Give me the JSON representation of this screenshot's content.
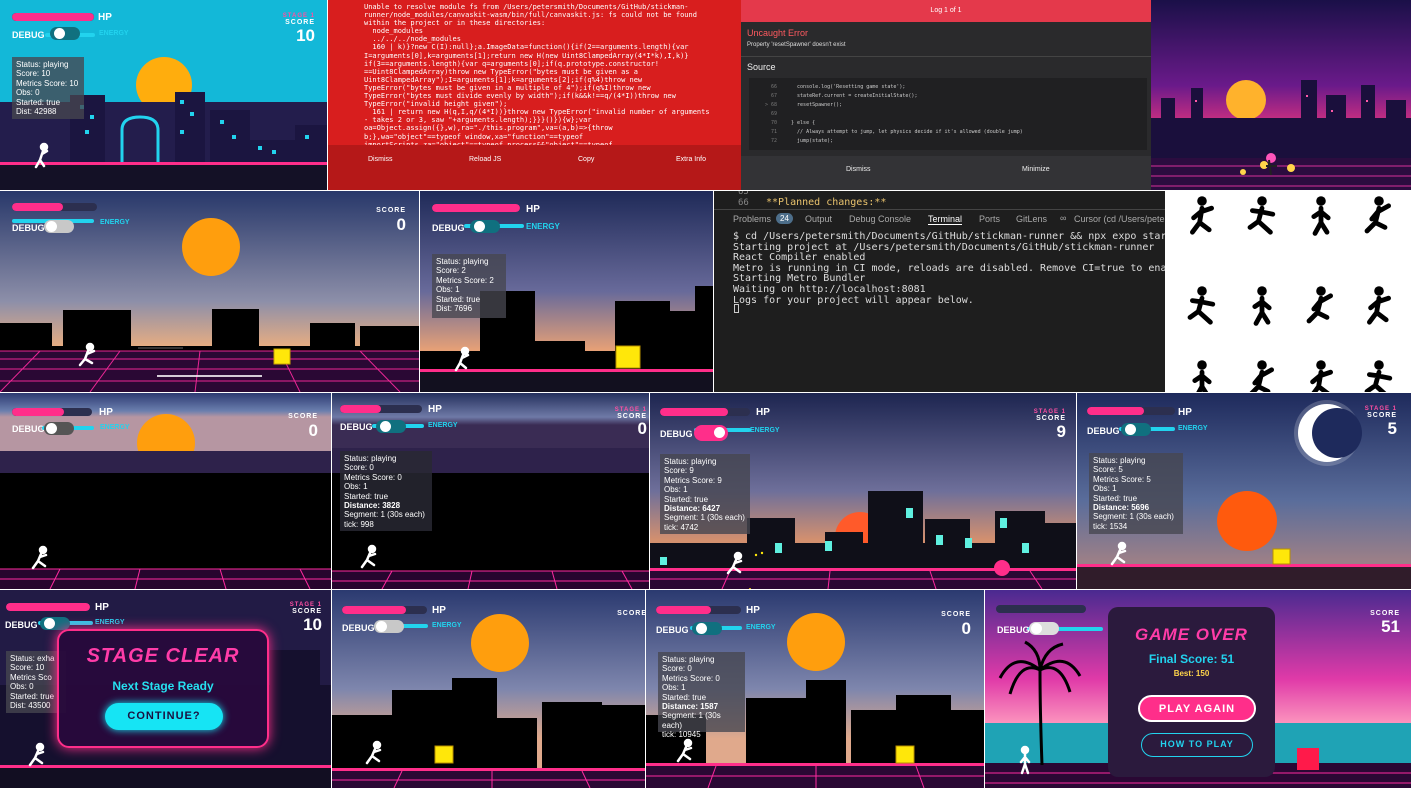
{
  "hud": {
    "hp": "HP",
    "debug": "DEBUG",
    "energy": "ENERGY",
    "score": "SCORE",
    "stage": "STAGE 1"
  },
  "tiles": {
    "t1": {
      "score": "10",
      "status": "Status: playing",
      "score_line": "Score: 10",
      "metrics": "Metrics Score: 10",
      "obs": "Obs: 0",
      "started": "Started: true",
      "dist": "Dist: 42988"
    },
    "t2": {
      "lines": [
        "Unable to resolve module fs from /Users/petersmith/Documents/GitHub/stickman-",
        "runner/node_modules/canvaskit-wasm/bin/full/canvaskit.js: fs could not be found",
        "within the project or in these directories:",
        "  node_modules",
        "  ../../../node_modules",
        "  160 | k)}?new C(I):null};a.ImageData=function(){if(2==arguments.length){var",
        "I=arguments[0],k=arguments[1];return new H(new Uint8ClampedArray(4*I*k),I,k)}",
        "if(3==arguments.length){var q=arguments[0];if(q.prototype.constructor!",
        "==Uint8ClampedArray)throw new TypeError(\"bytes must be given as a",
        "Uint8ClampedArray\");I=arguments[1];k=arguments[2];if(q%4)throw new",
        "TypeError(\"bytes must be given in a multiple of 4\");if(q%I)throw new",
        "TypeError(\"bytes must divide evenly by width\");if(k&&k!==q/(4*I))throw new",
        "TypeError(\"invalid height given\");",
        "  161 | return new H(q,I,q/(4*I))}throw new TypeError(\"invalid number of arguments",
        "- takes 2 or 3, saw \"+arguments.length);}}}()}){w};var",
        "oa=Object.assign({},w),ra=\"./this.program\",va=(a,b)=>{throw",
        "b;},wa=\"object\"==typeof window,xa=\"function\"==typeof",
        "importScripts,za=\"object\"==typeof process&&\"object\"==typeof"
      ],
      "buttons": [
        "Dismiss",
        "Reload JS",
        "Copy",
        "Extra Info"
      ]
    },
    "t3": {
      "title": "Log 1 of 1",
      "error_title": "Uncaught Error",
      "error_msg": "Property 'resetSpawner' doesn't exist",
      "source_label": "Source",
      "code": [
        {
          "n": "66",
          "t": "    console.log('Resetting game state');"
        },
        {
          "n": "67",
          "t": "    stateRef.current = createInitialState();"
        },
        {
          "n": "> 68",
          "t": "    resetSpawner();"
        },
        {
          "n": "69",
          "t": ""
        },
        {
          "n": "70",
          "t": "  } else {"
        },
        {
          "n": "71",
          "t": "    // Always attempt to jump, let physics decide if it's allowed (double jump)"
        },
        {
          "n": "72",
          "t": "    jump(state);"
        }
      ],
      "buttons": [
        "Dismiss",
        "Minimize"
      ]
    },
    "t5": {
      "score": "0"
    },
    "t6": {
      "score": "",
      "status": "Status: playing",
      "score_line": "Score: 2",
      "metrics": "Metrics Score: 2",
      "obs": "Obs: 1",
      "started": "Started: true",
      "dist": "Dist: 7696"
    },
    "t7": {
      "line_no": "65",
      "line_no2": "66",
      "planned": "**Planned changes:**",
      "tabs": [
        "Problems",
        "Output",
        "Debug Console",
        "Terminal",
        "Ports",
        "GitLens",
        "Cursor (cd /Users/peter"
      ],
      "problems_count": "24",
      "lines": [
        "$ cd /Users/petersmith/Documents/GitHub/stickman-runner && npx expo start",
        "Starting project at /Users/petersmith/Documents/GitHub/stickman-runner",
        "React Compiler enabled",
        "Metro is running in CI mode, reloads are disabled. Remove CI=true to enable watch mode.",
        "Starting Metro Bundler",
        "Waiting on http://localhost:8081",
        "Logs for your project will appear below."
      ]
    },
    "t9": {
      "score": "0"
    },
    "t10": {
      "score": "0",
      "status": "Status: playing",
      "score_line": "Score: 0",
      "metrics": "Metrics Score: 0",
      "obs": "Obs: 1",
      "started": "Started: true",
      "distance": "Distance: 3828",
      "segment": "Segment: 1 (30s each)",
      "tick": "tick: 998"
    },
    "t11": {
      "score": "9",
      "status": "Status: playing",
      "score_line": "Score: 9",
      "metrics": "Metrics Score: 9",
      "obs": "Obs: 1",
      "started": "Started: true",
      "distance": "Distance: 6427",
      "segment": "Segment: 1 (30s each)",
      "tick": "tick: 4742"
    },
    "t12": {
      "score": "5",
      "status": "Status: playing",
      "score_line": "Score: 5",
      "metrics": "Metrics Score: 5",
      "obs": "Obs: 1",
      "started": "Started: true",
      "distance": "Distance: 5696",
      "segment": "Segment: 1 (30s each)",
      "tick": "tick: 1534"
    },
    "t13": {
      "score": "10",
      "status": "Status: exha",
      "score_line": "Score: 10",
      "metrics": "Metrics Sco",
      "obs": "Obs: 0",
      "started": "Started: true",
      "dist": "Dist: 43500",
      "title": "STAGE CLEAR",
      "subtitle": "Next Stage Ready",
      "button": "CONTINUE?"
    },
    "t14": {
      "score": ""
    },
    "t15": {
      "score": "0",
      "status": "Status: playing",
      "score_line": "Score: 0",
      "metrics": "Metrics Score: 0",
      "obs": "Obs: 1",
      "started": "Started: true",
      "distance": "Distance: 1587",
      "segment": "Segment: 1 (30s each)",
      "tick": "tick: 10945"
    },
    "t16": {
      "score": "51",
      "title": "GAME OVER",
      "final": "Final Score: 51",
      "best": "Best: 150",
      "play": "PLAY AGAIN",
      "how": "HOW TO PLAY"
    }
  },
  "colors": {
    "accent_pink": "#ff2e8a",
    "accent_cyan": "#22d3ee",
    "red_error": "#d81e1e",
    "sun": "#ff9e0d",
    "obstacle_yellow": "#ffe70a"
  }
}
